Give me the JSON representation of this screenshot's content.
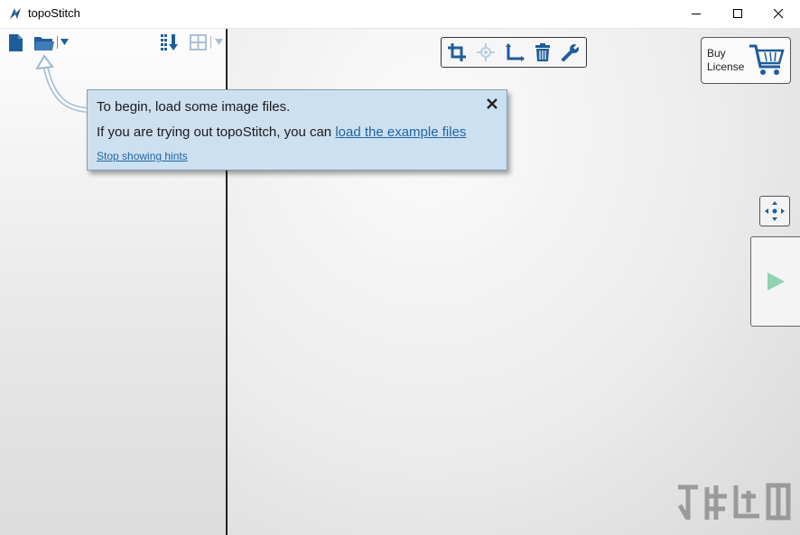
{
  "window": {
    "title": "topoStitch",
    "controls": [
      "minimize-icon",
      "maximize-icon",
      "close-icon"
    ]
  },
  "left_toolbar": {
    "buttons": [
      "new-file-icon",
      "open-folder-icon",
      "open-dropdown-icon",
      "sort-icon",
      "grid-view-icon",
      "grid-dropdown-icon"
    ]
  },
  "center_toolbar": {
    "buttons": [
      "crop-icon",
      "center-icon",
      "axes-icon",
      "trash-icon",
      "wrench-icon"
    ]
  },
  "buy_button": {
    "line1": "Buy",
    "line2": "License",
    "icon": "cart-icon"
  },
  "side_buttons": [
    "arrange-icon",
    "play-icon"
  ],
  "hint": {
    "line1": "To begin, load some image files.",
    "line2_prefix": "If you are trying out topoStitch, you can ",
    "line2_link": "load the example files",
    "stop_link": "Stop showing hints"
  },
  "colors": {
    "accent": "#1f64a6",
    "hint_bg": "#cde0ef",
    "icon_blue": "#1e5d9a",
    "play_green": "#8fd3b0"
  }
}
